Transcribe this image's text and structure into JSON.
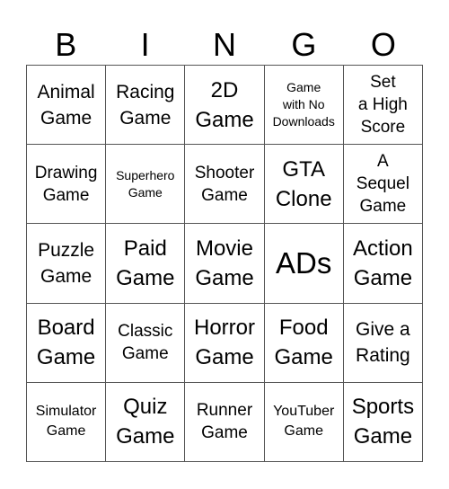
{
  "header": {
    "letters": [
      "B",
      "I",
      "N",
      "G",
      "O"
    ]
  },
  "grid": {
    "cells": [
      {
        "text": "Animal\nGame",
        "size": "fs-l"
      },
      {
        "text": "Racing\nGame",
        "size": "fs-l"
      },
      {
        "text": "2D\nGame",
        "size": "fs-xl"
      },
      {
        "text": "Game\nwith No\nDownloads",
        "size": "fs-xs"
      },
      {
        "text": "Set\na High\nScore",
        "size": "fs-m"
      },
      {
        "text": "Drawing\nGame",
        "size": "fs-m"
      },
      {
        "text": "Superhero\nGame",
        "size": "fs-xs"
      },
      {
        "text": "Shooter\nGame",
        "size": "fs-m"
      },
      {
        "text": "GTA\nClone",
        "size": "fs-xl"
      },
      {
        "text": "A\nSequel\nGame",
        "size": "fs-m"
      },
      {
        "text": "Puzzle\nGame",
        "size": "fs-l"
      },
      {
        "text": "Paid\nGame",
        "size": "fs-xl"
      },
      {
        "text": "Movie\nGame",
        "size": "fs-xl"
      },
      {
        "text": "ADs",
        "size": "fs-xxl"
      },
      {
        "text": "Action\nGame",
        "size": "fs-xl"
      },
      {
        "text": "Board\nGame",
        "size": "fs-xl"
      },
      {
        "text": "Classic\nGame",
        "size": "fs-m"
      },
      {
        "text": "Horror\nGame",
        "size": "fs-xl"
      },
      {
        "text": "Food\nGame",
        "size": "fs-xl"
      },
      {
        "text": "Give a\nRating",
        "size": "fs-l"
      },
      {
        "text": "Simulator\nGame",
        "size": "fs-s"
      },
      {
        "text": "Quiz\nGame",
        "size": "fs-xl"
      },
      {
        "text": "Runner\nGame",
        "size": "fs-m"
      },
      {
        "text": "YouTuber\nGame",
        "size": "fs-s"
      },
      {
        "text": "Sports\nGame",
        "size": "fs-xl"
      }
    ]
  }
}
